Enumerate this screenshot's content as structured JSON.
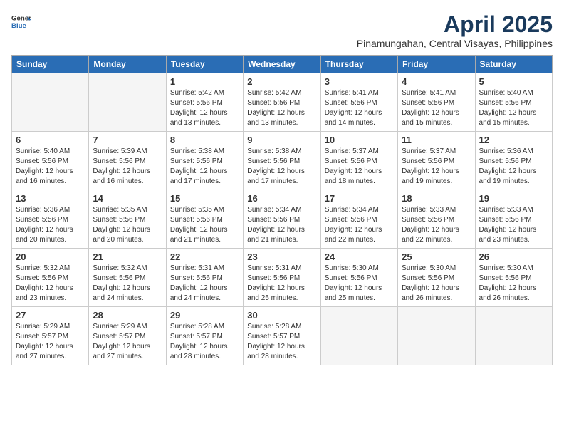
{
  "header": {
    "logo_general": "General",
    "logo_blue": "Blue",
    "month_title": "April 2025",
    "location": "Pinamungahan, Central Visayas, Philippines"
  },
  "weekdays": [
    "Sunday",
    "Monday",
    "Tuesday",
    "Wednesday",
    "Thursday",
    "Friday",
    "Saturday"
  ],
  "weeks": [
    [
      {
        "day": "",
        "info": ""
      },
      {
        "day": "",
        "info": ""
      },
      {
        "day": "1",
        "info": "Sunrise: 5:42 AM\nSunset: 5:56 PM\nDaylight: 12 hours and 13 minutes."
      },
      {
        "day": "2",
        "info": "Sunrise: 5:42 AM\nSunset: 5:56 PM\nDaylight: 12 hours and 13 minutes."
      },
      {
        "day": "3",
        "info": "Sunrise: 5:41 AM\nSunset: 5:56 PM\nDaylight: 12 hours and 14 minutes."
      },
      {
        "day": "4",
        "info": "Sunrise: 5:41 AM\nSunset: 5:56 PM\nDaylight: 12 hours and 15 minutes."
      },
      {
        "day": "5",
        "info": "Sunrise: 5:40 AM\nSunset: 5:56 PM\nDaylight: 12 hours and 15 minutes."
      }
    ],
    [
      {
        "day": "6",
        "info": "Sunrise: 5:40 AM\nSunset: 5:56 PM\nDaylight: 12 hours and 16 minutes."
      },
      {
        "day": "7",
        "info": "Sunrise: 5:39 AM\nSunset: 5:56 PM\nDaylight: 12 hours and 16 minutes."
      },
      {
        "day": "8",
        "info": "Sunrise: 5:38 AM\nSunset: 5:56 PM\nDaylight: 12 hours and 17 minutes."
      },
      {
        "day": "9",
        "info": "Sunrise: 5:38 AM\nSunset: 5:56 PM\nDaylight: 12 hours and 17 minutes."
      },
      {
        "day": "10",
        "info": "Sunrise: 5:37 AM\nSunset: 5:56 PM\nDaylight: 12 hours and 18 minutes."
      },
      {
        "day": "11",
        "info": "Sunrise: 5:37 AM\nSunset: 5:56 PM\nDaylight: 12 hours and 19 minutes."
      },
      {
        "day": "12",
        "info": "Sunrise: 5:36 AM\nSunset: 5:56 PM\nDaylight: 12 hours and 19 minutes."
      }
    ],
    [
      {
        "day": "13",
        "info": "Sunrise: 5:36 AM\nSunset: 5:56 PM\nDaylight: 12 hours and 20 minutes."
      },
      {
        "day": "14",
        "info": "Sunrise: 5:35 AM\nSunset: 5:56 PM\nDaylight: 12 hours and 20 minutes."
      },
      {
        "day": "15",
        "info": "Sunrise: 5:35 AM\nSunset: 5:56 PM\nDaylight: 12 hours and 21 minutes."
      },
      {
        "day": "16",
        "info": "Sunrise: 5:34 AM\nSunset: 5:56 PM\nDaylight: 12 hours and 21 minutes."
      },
      {
        "day": "17",
        "info": "Sunrise: 5:34 AM\nSunset: 5:56 PM\nDaylight: 12 hours and 22 minutes."
      },
      {
        "day": "18",
        "info": "Sunrise: 5:33 AM\nSunset: 5:56 PM\nDaylight: 12 hours and 22 minutes."
      },
      {
        "day": "19",
        "info": "Sunrise: 5:33 AM\nSunset: 5:56 PM\nDaylight: 12 hours and 23 minutes."
      }
    ],
    [
      {
        "day": "20",
        "info": "Sunrise: 5:32 AM\nSunset: 5:56 PM\nDaylight: 12 hours and 23 minutes."
      },
      {
        "day": "21",
        "info": "Sunrise: 5:32 AM\nSunset: 5:56 PM\nDaylight: 12 hours and 24 minutes."
      },
      {
        "day": "22",
        "info": "Sunrise: 5:31 AM\nSunset: 5:56 PM\nDaylight: 12 hours and 24 minutes."
      },
      {
        "day": "23",
        "info": "Sunrise: 5:31 AM\nSunset: 5:56 PM\nDaylight: 12 hours and 25 minutes."
      },
      {
        "day": "24",
        "info": "Sunrise: 5:30 AM\nSunset: 5:56 PM\nDaylight: 12 hours and 25 minutes."
      },
      {
        "day": "25",
        "info": "Sunrise: 5:30 AM\nSunset: 5:56 PM\nDaylight: 12 hours and 26 minutes."
      },
      {
        "day": "26",
        "info": "Sunrise: 5:30 AM\nSunset: 5:56 PM\nDaylight: 12 hours and 26 minutes."
      }
    ],
    [
      {
        "day": "27",
        "info": "Sunrise: 5:29 AM\nSunset: 5:57 PM\nDaylight: 12 hours and 27 minutes."
      },
      {
        "day": "28",
        "info": "Sunrise: 5:29 AM\nSunset: 5:57 PM\nDaylight: 12 hours and 27 minutes."
      },
      {
        "day": "29",
        "info": "Sunrise: 5:28 AM\nSunset: 5:57 PM\nDaylight: 12 hours and 28 minutes."
      },
      {
        "day": "30",
        "info": "Sunrise: 5:28 AM\nSunset: 5:57 PM\nDaylight: 12 hours and 28 minutes."
      },
      {
        "day": "",
        "info": ""
      },
      {
        "day": "",
        "info": ""
      },
      {
        "day": "",
        "info": ""
      }
    ]
  ]
}
